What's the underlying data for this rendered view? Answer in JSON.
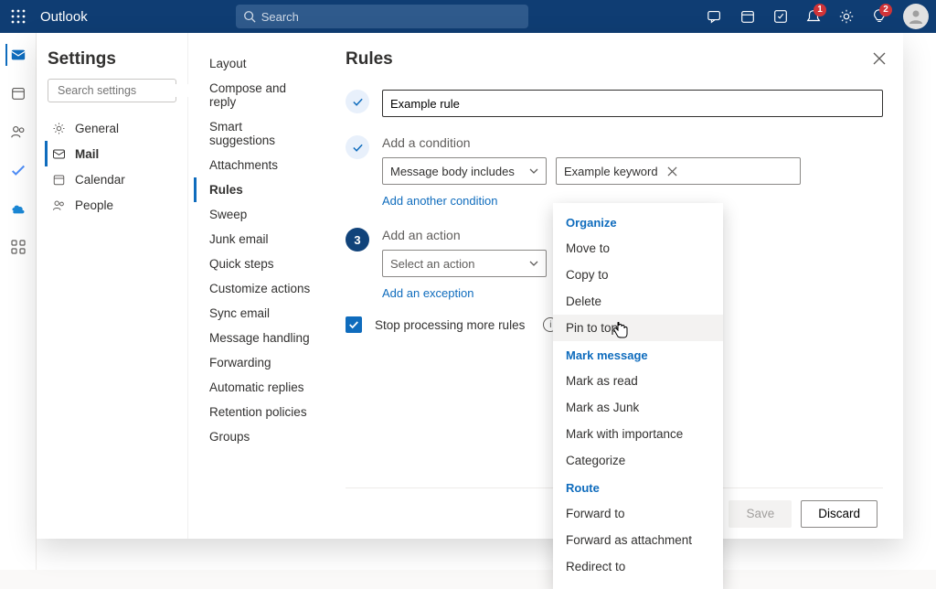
{
  "topbar": {
    "brand": "Outlook",
    "search_placeholder": "Search",
    "badges": {
      "bell": "1",
      "tips": "2"
    }
  },
  "settings": {
    "title": "Settings",
    "search_placeholder": "Search settings",
    "nav": [
      {
        "label": "General"
      },
      {
        "label": "Mail"
      },
      {
        "label": "Calendar"
      },
      {
        "label": "People"
      }
    ],
    "subnav": [
      {
        "label": "Layout"
      },
      {
        "label": "Compose and reply"
      },
      {
        "label": "Smart suggestions"
      },
      {
        "label": "Attachments"
      },
      {
        "label": "Rules"
      },
      {
        "label": "Sweep"
      },
      {
        "label": "Junk email"
      },
      {
        "label": "Quick steps"
      },
      {
        "label": "Customize actions"
      },
      {
        "label": "Sync email"
      },
      {
        "label": "Message handling"
      },
      {
        "label": "Forwarding"
      },
      {
        "label": "Automatic replies"
      },
      {
        "label": "Retention policies"
      },
      {
        "label": "Groups"
      }
    ]
  },
  "rules": {
    "title": "Rules",
    "rule_name": "Example rule",
    "step2_label": "Add a condition",
    "condition_dropdown": "Message body includes",
    "condition_value": "Example keyword",
    "add_condition": "Add another condition",
    "step3_label": "Add an action",
    "step3_num": "3",
    "action_placeholder": "Select an action",
    "add_exception": "Add an exception",
    "stop_processing": "Stop processing more rules",
    "save": "Save",
    "discard": "Discard"
  },
  "action_menu": {
    "groups": [
      {
        "header": "Organize",
        "items": [
          "Move to",
          "Copy to",
          "Delete",
          "Pin to top"
        ]
      },
      {
        "header": "Mark message",
        "items": [
          "Mark as read",
          "Mark as Junk",
          "Mark with importance",
          "Categorize"
        ]
      },
      {
        "header": "Route",
        "items": [
          "Forward to",
          "Forward as attachment",
          "Redirect to"
        ]
      }
    ],
    "hovered": "Pin to top"
  }
}
